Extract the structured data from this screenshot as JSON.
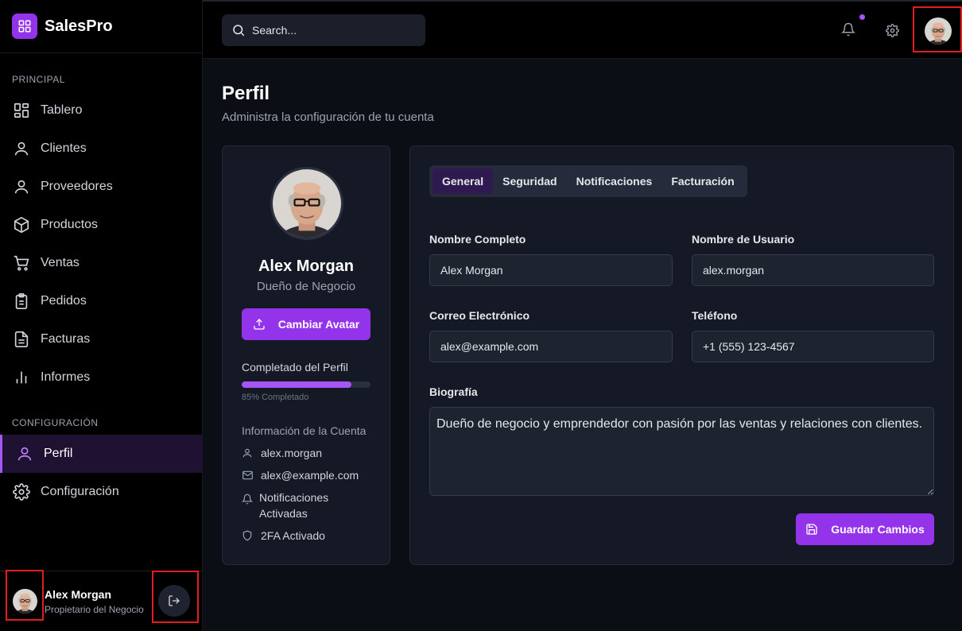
{
  "brand": {
    "name": "SalesPro"
  },
  "sidebar": {
    "section_principal": "PRINCIPAL",
    "section_config": "CONFIGURACIÓN",
    "items": [
      {
        "label": "Tablero",
        "icon": "dashboard-icon"
      },
      {
        "label": "Clientes",
        "icon": "user-icon"
      },
      {
        "label": "Proveedores",
        "icon": "user-icon"
      },
      {
        "label": "Productos",
        "icon": "box-icon"
      },
      {
        "label": "Ventas",
        "icon": "cart-icon"
      },
      {
        "label": "Pedidos",
        "icon": "clipboard-icon"
      },
      {
        "label": "Facturas",
        "icon": "file-icon"
      },
      {
        "label": "Informes",
        "icon": "bar-chart-icon"
      }
    ],
    "config_items": [
      {
        "label": "Perfil",
        "icon": "user-icon",
        "active": true
      },
      {
        "label": "Configuración",
        "icon": "gear-icon"
      }
    ],
    "footer": {
      "name": "Alex Morgan",
      "role": "Propietario del Negocio"
    }
  },
  "topbar": {
    "search_placeholder": "Search..."
  },
  "page": {
    "title": "Perfil",
    "subtitle": "Administra la configuración de tu cuenta"
  },
  "profile_card": {
    "name": "Alex Morgan",
    "role": "Dueño de Negocio",
    "change_avatar": "Cambiar Avatar",
    "completion_label": "Completado del Perfil",
    "completion_percent": 85,
    "completion_text": "85% Completado",
    "account_info_title": "Información de la Cuenta",
    "account_info": [
      {
        "icon": "user-icon",
        "text": "alex.morgan"
      },
      {
        "icon": "mail-icon",
        "text": "alex@example.com"
      },
      {
        "icon": "bell-icon",
        "text": "Notificaciones Activadas"
      },
      {
        "icon": "shield-icon",
        "text": "2FA Activado"
      }
    ]
  },
  "settings": {
    "tabs": [
      "General",
      "Seguridad",
      "Notificaciones",
      "Facturación"
    ],
    "active_tab": "General",
    "fields": {
      "full_name_label": "Nombre Completo",
      "full_name_value": "Alex Morgan",
      "username_label": "Nombre de Usuario",
      "username_value": "alex.morgan",
      "email_label": "Correo Electrónico",
      "email_value": "alex@example.com",
      "phone_label": "Teléfono",
      "phone_value": "+1 (555) 123-4567",
      "bio_label": "Biografía",
      "bio_value": "Dueño de negocio y emprendedor con pasión por las ventas y relaciones con clientes."
    },
    "save_label": "Guardar Cambios"
  },
  "colors": {
    "accent": "#9333ea",
    "accent_light": "#a855f7",
    "background": "#0c0e16",
    "card": "#141925"
  }
}
